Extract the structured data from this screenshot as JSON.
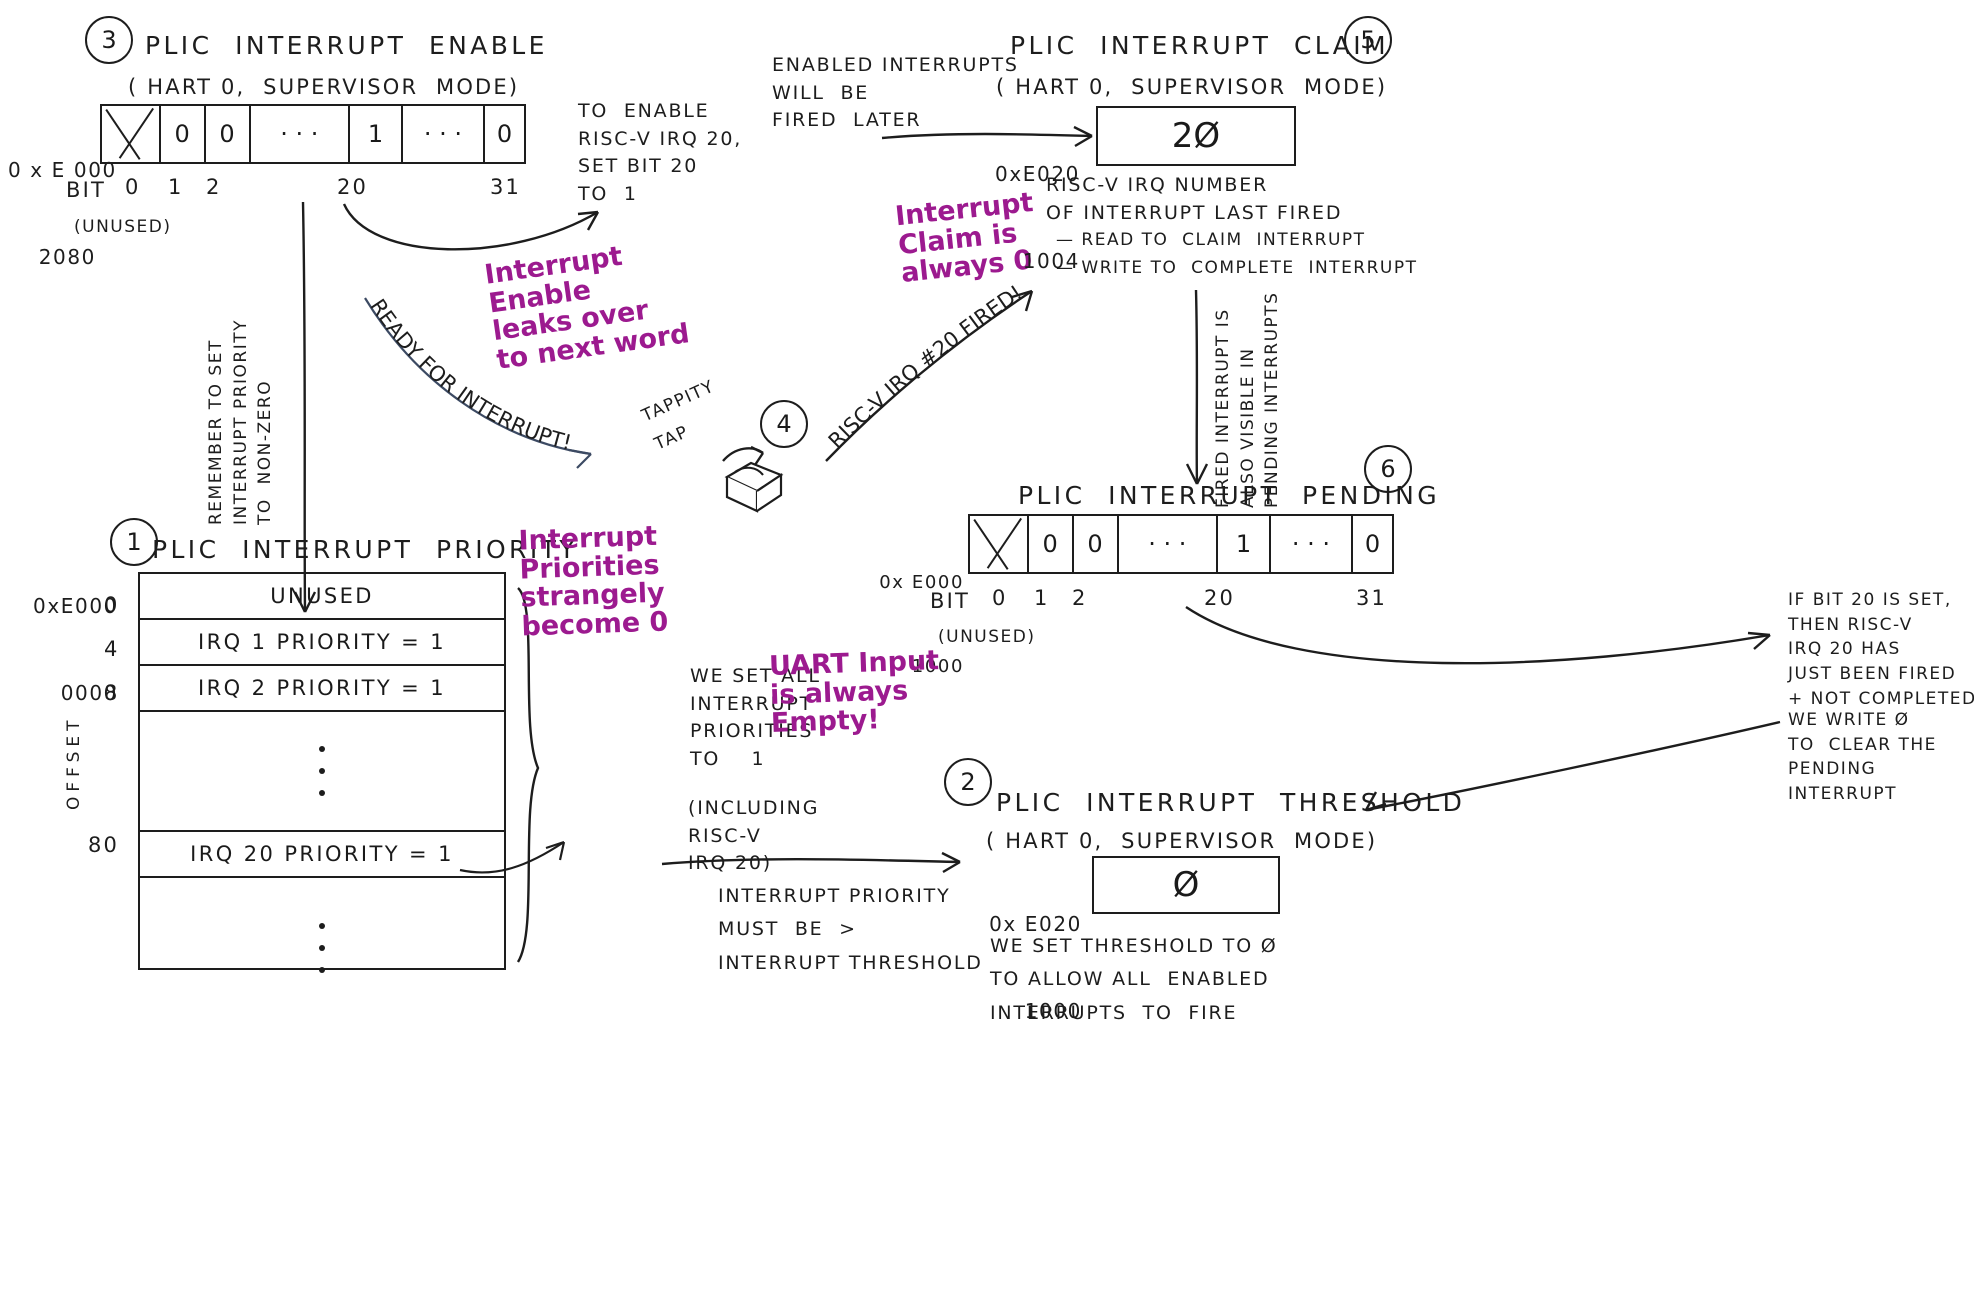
{
  "meta": {
    "accent_purple": "#9c1a8f",
    "ink": "#1d1d1d"
  },
  "steps": {
    "s1": "1",
    "s2": "2",
    "s3": "3",
    "s4": "4",
    "s5": "5",
    "s6": "6"
  },
  "interrupt_enable": {
    "title": "PLIC  INTERRUPT  ENABLE",
    "subtitle": "( HART 0,  SUPERVISOR  MODE)",
    "address_line1": "0 x E 000",
    "address_line2": "2080",
    "cells": [
      "",
      "0",
      "0",
      "· · ·",
      "1",
      "· · ·",
      "0"
    ],
    "bit_label": "BIT",
    "bit_ticks": [
      "0",
      "1",
      "2",
      "20",
      "31"
    ],
    "unused_label": "(UNUSED)",
    "note_enable": "TO  ENABLE\nRISC-V IRQ 20,\nSET BIT 20\nTO  1",
    "note_fired": "ENABLED INTERRUPTS\nWILL  BE\nFIRED  LATER",
    "vertical_note": "REMEMBER TO SET\nINTERRUPT PRIORITY\nTO  NON-ZERO"
  },
  "interrupt_claim": {
    "title": "PLIC  INTERRUPT  CLAIM",
    "subtitle": "( HART 0,  SUPERVISOR  MODE)",
    "address_line1": "0xE020",
    "address_line2": "1004",
    "value": "2Ø",
    "notes": "RISC-V IRQ NUMBER\nOF INTERRUPT LAST FIRED",
    "bullets": [
      "— READ TO  CLAIM  INTERRUPT",
      "— WRITE TO  COMPLETE  INTERRUPT"
    ],
    "vertical_note": "FIRED INTERRUPT IS\nALSO VISIBLE IN\nPENDING INTERRUPTS"
  },
  "interrupt_pending": {
    "title": "PLIC  INTERRUPT  PENDING",
    "address_line1": "0x E000",
    "address_line2": "1000",
    "cells": [
      "",
      "0",
      "0",
      "· · ·",
      "1",
      "· · ·",
      "0"
    ],
    "bit_label": "BIT",
    "bit_ticks": [
      "0",
      "1",
      "2",
      "20",
      "31"
    ],
    "unused_label": "(UNUSED)",
    "note_set": "IF BIT 20 IS SET,\nTHEN RISC-V\nIRQ 20 HAS\nJUST BEEN FIRED\n+ NOT COMPLETED",
    "note_clear": "WE WRITE Ø\nTO  CLEAR THE\nPENDING\nINTERRUPT"
  },
  "interrupt_priority": {
    "title": "PLIC  INTERRUPT  PRIORITY",
    "address_line1": "0xE000",
    "address_line2": "0000",
    "offset_label": "OFFSET",
    "offsets": [
      "0",
      "4",
      "8",
      "80"
    ],
    "rows": [
      "UNUSED",
      "IRQ 1  PRIORITY  = 1",
      "IRQ 2  PRIORITY  = 1",
      "IRQ 20 PRIORITY = 1"
    ],
    "note": "WE SET ALL\nINTERRUPT\nPRIORITIES\nTO    1",
    "note2": "(INCLUDING\nRISC-V\nIRQ 20)"
  },
  "interrupt_threshold": {
    "title": "PLIC  INTERRUPT  THRESHOLD",
    "subtitle": "( HART 0,  SUPERVISOR  MODE)",
    "address_line1": "0x E020",
    "address_line2": "1000",
    "value": "Ø",
    "note": "WE SET THRESHOLD TO Ø\nTO ALLOW ALL  ENABLED\nINTERRUPTS  TO  FIRE",
    "arrow_note": "INTERRUPT PRIORITY\nMUST  BE  >\nINTERRUPT THRESHOLD"
  },
  "annotations": {
    "enable_leaks": "Interrupt\nEnable\nleaks over\nto next word",
    "claim_zero": "Interrupt\nClaim is\nalways 0",
    "priorities_zero": "Interrupt\nPriorities\nstrangely\nbecome 0",
    "uart_empty": "UART Input\nis always\nEmpty!"
  },
  "arcs": {
    "ready_for_interrupt": "READY  FOR  INTERRUPT!",
    "tappity_tap": "TAPPITY\nTAP",
    "irq_fired": "RISC-V IRQ  #20 FIRED!"
  }
}
